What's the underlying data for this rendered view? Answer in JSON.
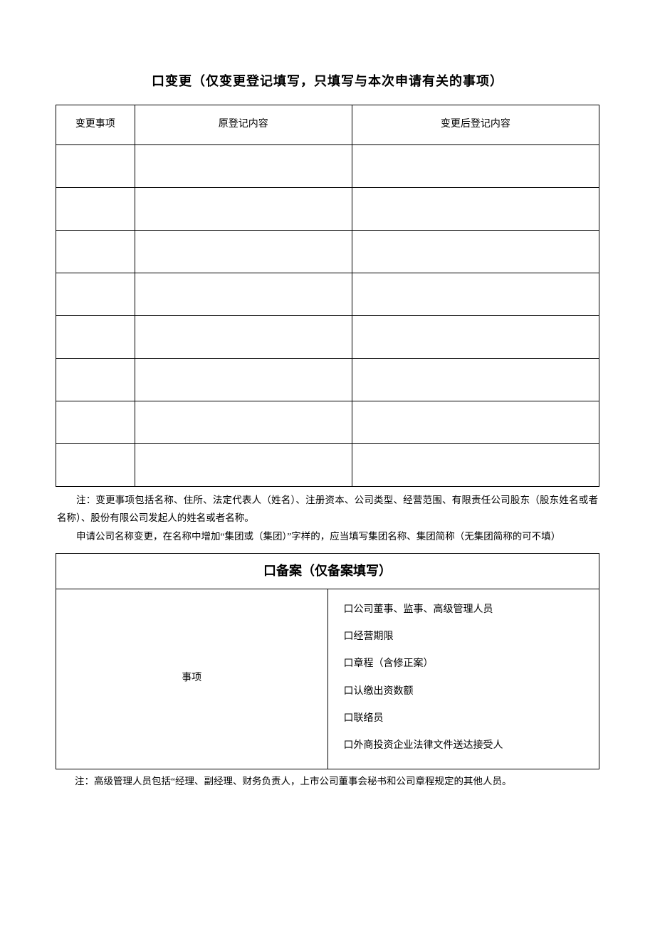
{
  "changeSection": {
    "title": "口变更（仅变更登记填写，只填写与本次申请有关的事项）",
    "headers": {
      "item": "变更事项",
      "original": "原登记内容",
      "after": "变更后登记内容"
    },
    "rows": [
      {
        "item": "",
        "original": "",
        "after": ""
      },
      {
        "item": "",
        "original": "",
        "after": ""
      },
      {
        "item": "",
        "original": "",
        "after": ""
      },
      {
        "item": "",
        "original": "",
        "after": ""
      },
      {
        "item": "",
        "original": "",
        "after": ""
      },
      {
        "item": "",
        "original": "",
        "after": ""
      },
      {
        "item": "",
        "original": "",
        "after": ""
      },
      {
        "item": "",
        "original": "",
        "after": ""
      }
    ],
    "note_line1": "注：变更事项包括名称、住所、法定代表人（姓名）、注册资本、公司类型、经营范围、有限责任公司股东（股东姓名或者名称）、股份有限公司发起人的姓名或者名称。",
    "note_line2": "申请公司名称变更，在名称中增加“集团或（集团）”字样的，应当填写集团名称、集团简称（无集团简称的可不填）"
  },
  "filingSection": {
    "title": "口备案（仅备案填写）",
    "rowLabel": "事项",
    "options": [
      "口公司董事、监事、高级管理人员",
      "口经营期限",
      "口章程（含修正案）",
      "口认缴出资数额",
      "口联络员",
      "口外商投资企业法律文件送达接受人"
    ],
    "footnote": "注：高级管理人员包括“经理、副经理、财务负责人，上市公司董事会秘书和公司章程规定的其他人员。"
  }
}
